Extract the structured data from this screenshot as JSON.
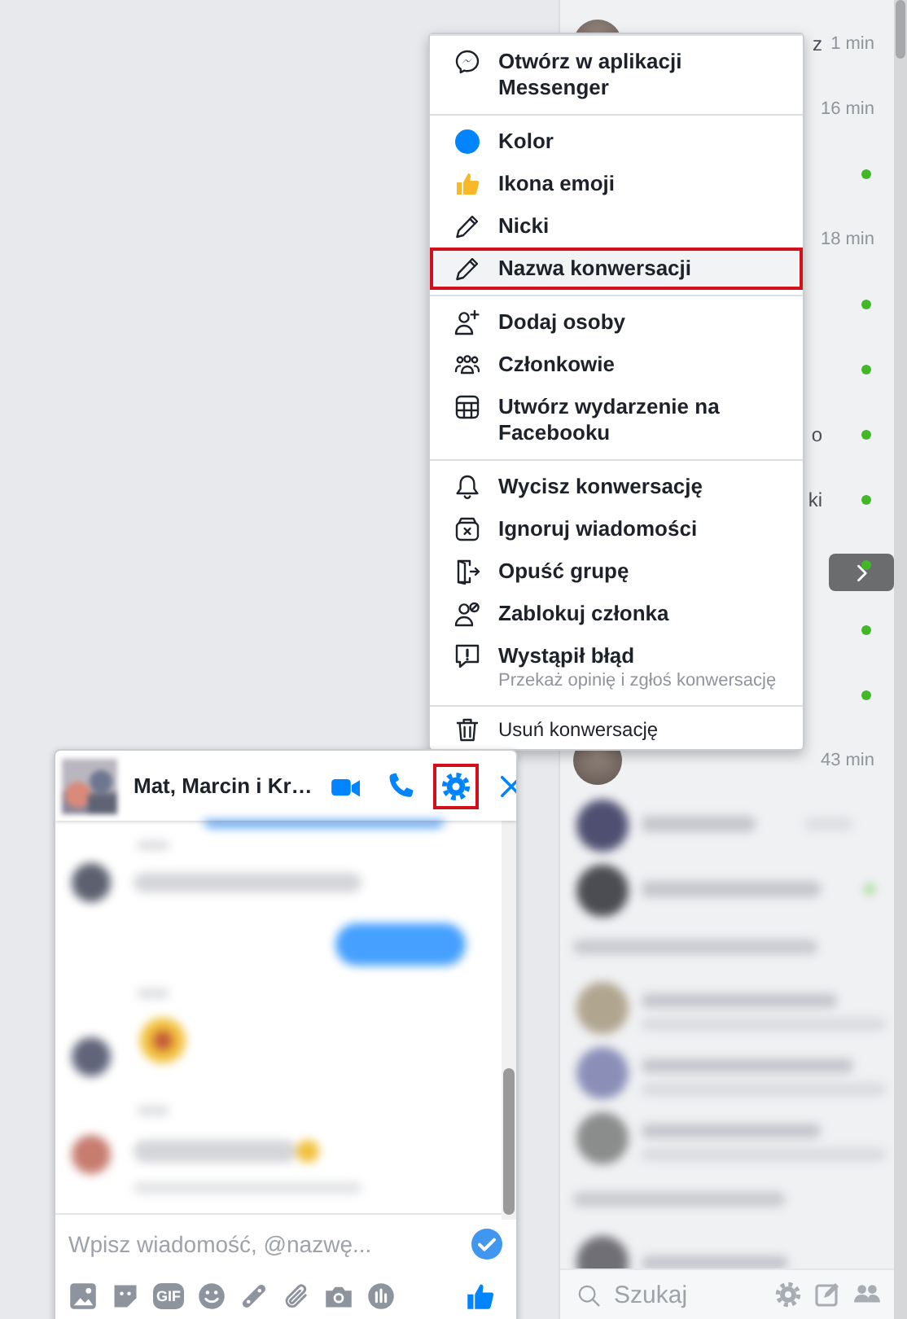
{
  "menu": {
    "sections": [
      {
        "items": [
          {
            "label": "Otwórz w aplikacji Messenger",
            "kind": "action",
            "highlighted": false
          }
        ]
      },
      {
        "items": [
          {
            "label": "Kolor",
            "kind": "action",
            "highlighted": false
          },
          {
            "label": "Ikona emoji",
            "kind": "action",
            "highlighted": false
          },
          {
            "label": "Nicki",
            "kind": "action",
            "highlighted": false
          },
          {
            "label": "Nazwa konwersacji",
            "kind": "action",
            "highlighted": true
          }
        ]
      },
      {
        "items": [
          {
            "label": "Dodaj osoby",
            "kind": "action",
            "highlighted": false
          },
          {
            "label": "Członkowie",
            "kind": "action",
            "highlighted": false
          },
          {
            "label": "Utwórz wydarzenie na Facebooku",
            "kind": "action",
            "highlighted": false
          }
        ]
      },
      {
        "items": [
          {
            "label": "Wycisz konwersację",
            "kind": "action",
            "highlighted": false
          },
          {
            "label": "Ignoruj wiadomości",
            "kind": "action",
            "highlighted": false
          },
          {
            "label": "Opuść grupę",
            "kind": "action",
            "highlighted": false
          },
          {
            "label": "Zablokuj członka",
            "kind": "action",
            "highlighted": false
          },
          {
            "label": "Wystąpił błąd",
            "sublabel": "Przekaż opinię i zgłoś konwersację",
            "kind": "action",
            "highlighted": false
          }
        ]
      },
      {
        "items": [
          {
            "label": "Usuń konwersację",
            "kind": "minor",
            "highlighted": false
          }
        ]
      }
    ]
  },
  "contacts": [
    {
      "fragment": "z",
      "time": "1 min",
      "avatar": true
    },
    {
      "time": "16 min"
    },
    {
      "online": true
    },
    {
      "time": "18 min"
    },
    {
      "online": true
    },
    {
      "online": true
    },
    {
      "fragment": "o",
      "online": true
    },
    {
      "fragment": "ki",
      "online": true
    },
    {
      "online": true
    },
    {
      "online": true
    },
    {
      "online": true
    },
    {
      "time": "43 min",
      "avatar": true
    }
  ],
  "sidebar_search": {
    "placeholder": "Szukaj"
  },
  "chat": {
    "title": "Mat, Marcin i Kr…",
    "settings_highlighted": true,
    "composer": {
      "placeholder": "Wpisz wiadomość, @nazwę..."
    },
    "gif_label": "GIF"
  }
}
